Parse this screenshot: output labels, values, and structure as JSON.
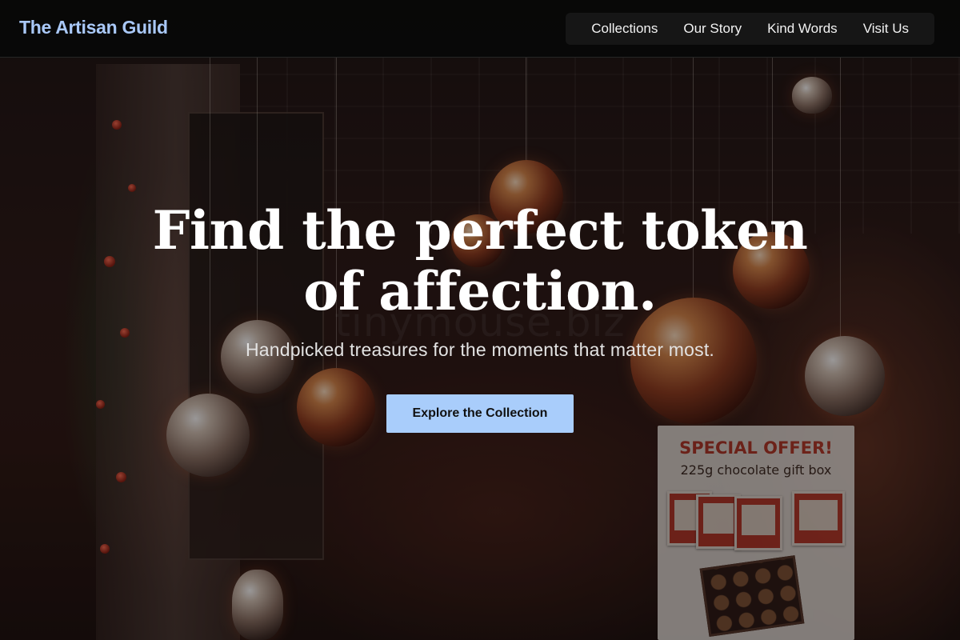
{
  "navbar": {
    "brand": "The Artisan Guild",
    "links": [
      {
        "label": "Collections"
      },
      {
        "label": "Our Story"
      },
      {
        "label": "Kind Words"
      },
      {
        "label": "Visit Us"
      }
    ]
  },
  "hero": {
    "title": "Find the perfect token of affection.",
    "subtitle": "Handpicked treasures for the moments that matter most.",
    "cta_label": "Explore the Collection"
  },
  "background_photo": {
    "offer_title": "SPECIAL OFFER!",
    "offer_subtitle": "225g chocolate gift box",
    "watermark": "tinymouse.biz"
  },
  "colors": {
    "brand": "#a9c8f7",
    "cta_background": "#a9cdfb",
    "navbar_background": "#080808"
  }
}
